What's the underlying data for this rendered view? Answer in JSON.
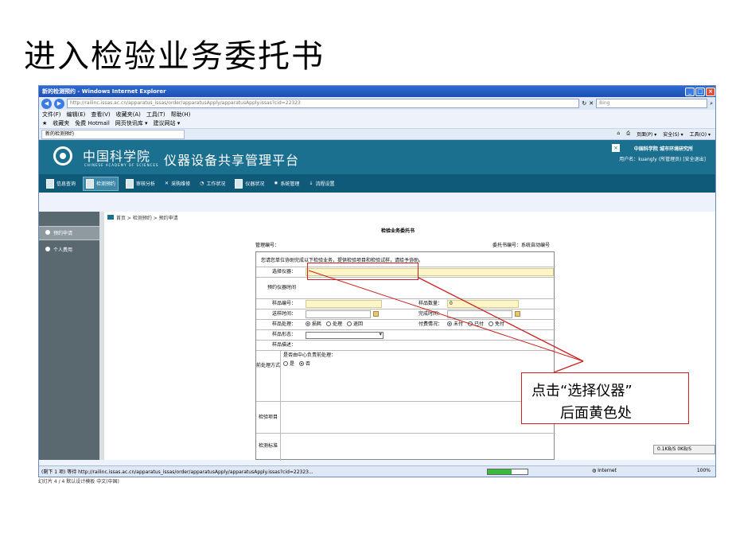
{
  "slide": {
    "title": "进入检验业务委托书",
    "callout_line1": "点击“选择仪器”",
    "callout_line2": "后面黄色处"
  },
  "browser": {
    "window_title": "新的检测预约 - Windows Internet Explorer",
    "address": "http://railinc.issas.ac.cn/apparatus_issas/order/apparatusApply/apparatusApply.issas?cid=22323",
    "search_placeholder": "Bing",
    "menus": [
      "文件(F)",
      "编辑(E)",
      "查看(V)",
      "收藏夹(A)",
      "工具(T)",
      "帮助(H)"
    ],
    "favorites": [
      "收藏夹",
      "免费 Hotmail",
      "网页快讯库 ▾",
      "建议网站 ▾"
    ],
    "tab_label": "新的检测预约",
    "tab_tools": [
      "页面(P) ▾",
      "安全(S) ▾",
      "工具(O) ▾"
    ],
    "status_text": "(剩下 1 项) 等待 http://railinc.issas.ac.cn/apparatus_issas/order/apparatusApply/apparatusApply.issas?cid=22323...",
    "zone": "Internet",
    "zoom": "100%",
    "speed": "0.1KB/S   0KB/S",
    "bottom_fragment": "幻灯片 4 / 4        默认设计模板        中文(中国)"
  },
  "site": {
    "org_cn": "中国科学院",
    "org_en": "CHINESE ACADEMY OF SCIENCES",
    "platform_title": "仪器设备共享管理平台",
    "institute": "中国科学院 城市环境研究所",
    "user_line": "用户名：kuangly (所管理员) [安全退出]",
    "nav": [
      "信息查询",
      "检测预约",
      "审核分析",
      "采购维修",
      "工作状况",
      "仪器状况",
      "系统管理",
      "流程设置"
    ],
    "nav_active": "检测预约",
    "left_menu": [
      "预约申请",
      "个人费用"
    ],
    "breadcrumb": "首页  >  检测预约  >  预约申请"
  },
  "form": {
    "title": "检验业务委托书",
    "manage_no": "管理编号：",
    "entrust_no": "委托书编号：系统自动编号",
    "intro": "您请您单位协助完成以下检验业务，提供检验项目和检验试样，请给予协助。",
    "instrument_label": "选择仪器：",
    "reserve_time_label": "预约仪器时间",
    "sample_no_label": "样品编号：",
    "sample_count_label": "样品数量：",
    "sample_count_value": "0",
    "send_time_label": "送样时间：",
    "finish_time_label": "完成时间：",
    "sample_process_label": "样品处理：",
    "sample_process_options": [
      "损耗",
      "处理",
      "退回"
    ],
    "payment_label": "付费情况：",
    "payment_options": [
      "未付",
      "已付",
      "免付"
    ],
    "sample_state_label": "样品形态：",
    "sample_desc_label": "样品描述：",
    "pretreat_label": "前处理方式",
    "pretreat_question": "是否由中心负责前处理：",
    "pretreat_options": [
      "是",
      "否"
    ],
    "test_item_label": "检验项目",
    "test_standard_label": "检测标准"
  }
}
